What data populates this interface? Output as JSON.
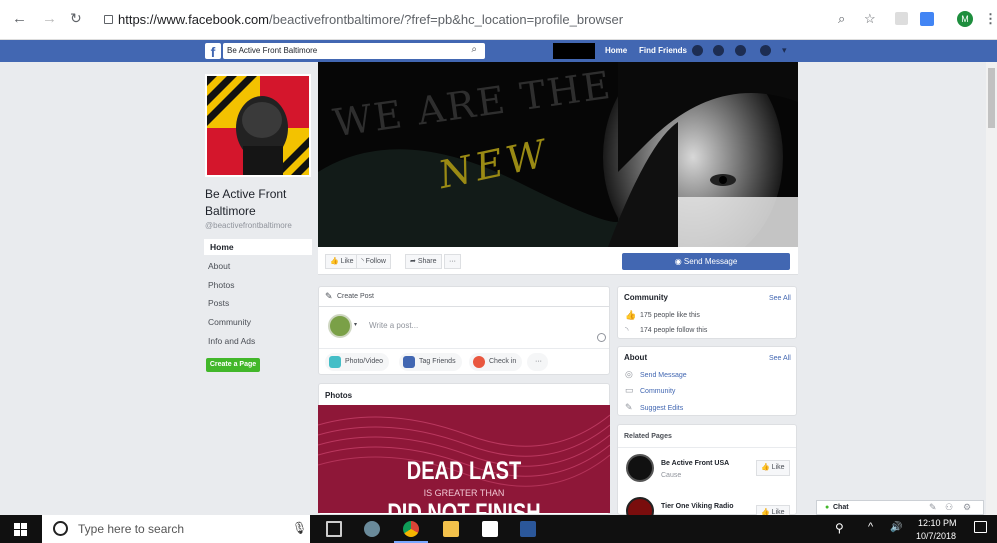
{
  "browser": {
    "url_host": "https://www.facebook.com",
    "url_path": "/beactivefrontbaltimore/?fref=pb&hc_location=profile_browser",
    "avatar_letter": "M"
  },
  "fb": {
    "search_value": "Be Active Front Baltimore",
    "nav_home": "Home",
    "nav_find_friends": "Find Friends"
  },
  "page": {
    "name": "Be Active Front Baltimore",
    "handle": "@beactivefrontbaltimore",
    "nav": [
      "Home",
      "About",
      "Photos",
      "Posts",
      "Community",
      "Info and Ads"
    ],
    "create_page": "Create a Page"
  },
  "cover": {
    "text_top": "WE ARE THE",
    "text_mid": "NEW"
  },
  "actions": {
    "like": "Like",
    "follow": "Follow",
    "share": "Share",
    "more": "···",
    "send_message": "Send Message"
  },
  "create_post": {
    "title": "Create Post",
    "placeholder": "Write a post...",
    "photo_video": "Photo/Video",
    "tag_friends": "Tag Friends",
    "check_in": "Check in",
    "more": "···"
  },
  "photos": {
    "title": "Photos",
    "line1": "DEAD LAST",
    "line2": "IS GREATER THAN",
    "line3": "DID NOT FINISH"
  },
  "community": {
    "title": "Community",
    "see_all": "See All",
    "likes": "175 people like this",
    "follows": "174 people follow this"
  },
  "about": {
    "title": "About",
    "see_all": "See All",
    "send_message": "Send Message",
    "community": "Community",
    "suggest_edits": "Suggest Edits"
  },
  "related": {
    "title": "Related Pages",
    "items": [
      {
        "name": "Be Active Front USA",
        "category": "Cause",
        "button": "Like"
      },
      {
        "name": "Tier One Viking Radio",
        "category": "",
        "button": "Like"
      }
    ]
  },
  "chat": {
    "label": "Chat"
  },
  "taskbar": {
    "search_placeholder": "Type here to search",
    "time": "12:10 PM",
    "date": "10/7/2018"
  },
  "colors": {
    "fb_blue": "#4267b2",
    "create_green": "#42b72a"
  }
}
